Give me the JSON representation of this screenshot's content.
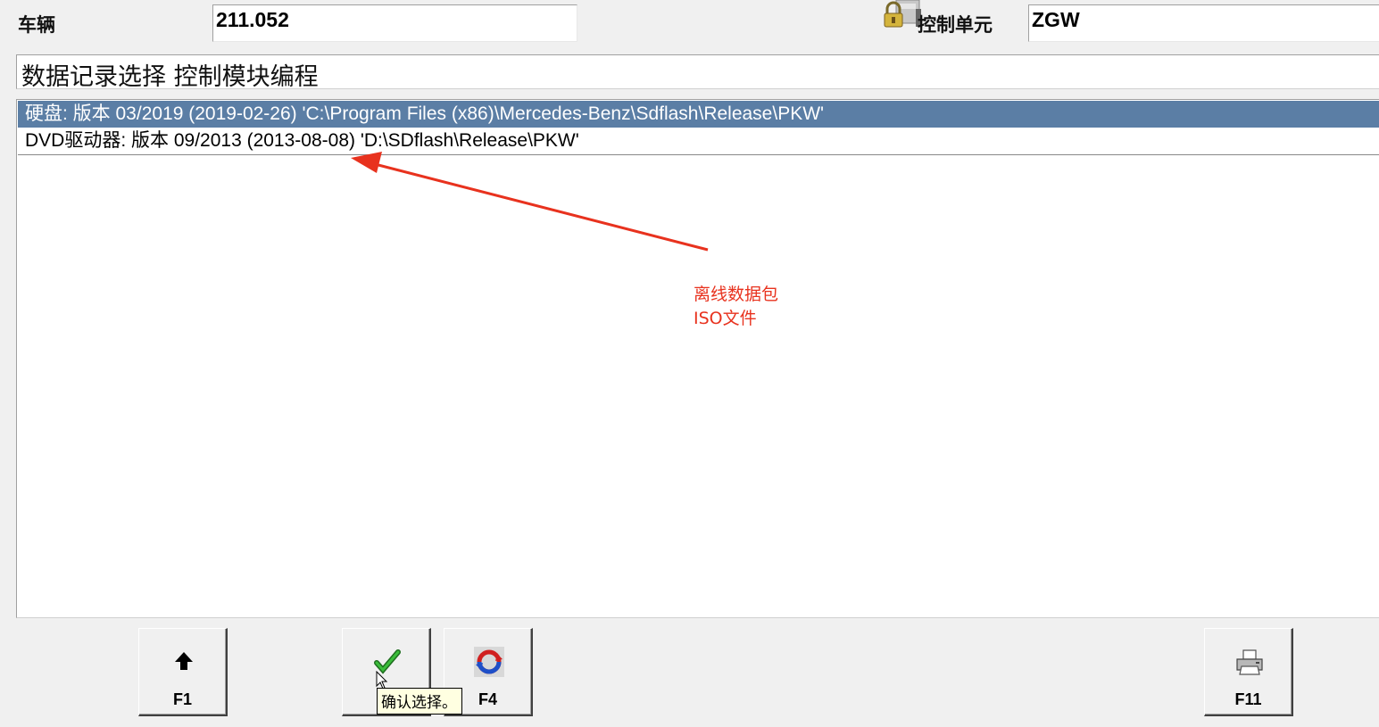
{
  "header": {
    "vehicle_label": "车辆",
    "vehicle_value": "211.052",
    "ecu_label": "控制单元",
    "ecu_value": "ZGW"
  },
  "title": "数据记录选择 控制模块编程",
  "list": {
    "items": [
      {
        "label": "硬盘: 版本 03/2019 (2019-02-26) 'C:\\Program Files (x86)\\Mercedes-Benz\\Sdflash\\Release\\PKW'",
        "selected": true
      },
      {
        "label": "DVD驱动器: 版本 09/2013 (2013-08-08) 'D:\\SDflash\\Release\\PKW'",
        "selected": false
      }
    ],
    "selected_color": "#5b7ea5"
  },
  "annotation": {
    "line1": "离线数据包",
    "line2": "ISO文件",
    "color": "#e8321e"
  },
  "buttons": {
    "f1": {
      "key": "F1",
      "icon": "arrow-up-icon"
    },
    "ok": {
      "key": "",
      "icon": "checkmark-icon"
    },
    "f4": {
      "key": "F4",
      "icon": "refresh-icon"
    },
    "f11": {
      "key": "F11",
      "icon": "printer-icon"
    }
  },
  "tooltip": "确认选择。"
}
